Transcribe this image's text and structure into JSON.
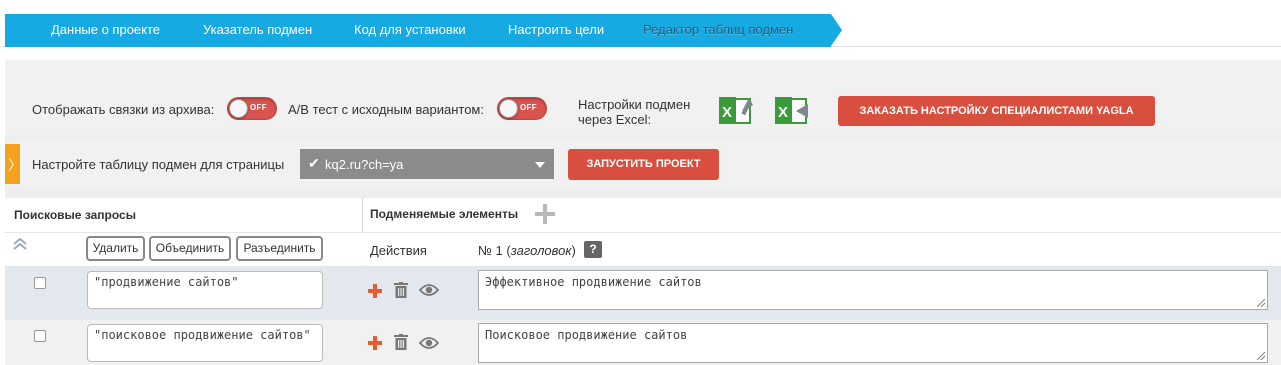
{
  "tabs": [
    {
      "label": "Данные о проекте"
    },
    {
      "label": "Указатель подмен"
    },
    {
      "label": "Код для установки"
    },
    {
      "label": "Настроить цели"
    },
    {
      "label": "Редактор таблиц подмен"
    }
  ],
  "settings": {
    "archive_label": "Отображать связки из архива:",
    "ab_label": "A/B тест с исходным вариантом:",
    "toggle_off": "OFF",
    "excel_label_line1": "Настройки подмен",
    "excel_label_line2": "через Excel:",
    "order_button": "Заказать настройку специалистами YAGLA"
  },
  "page_row": {
    "side_tab_glyph": "〉",
    "label": "Настройте таблицу подмен для страницы",
    "select_value": "kq2.ru?ch=ya",
    "launch_button": "Запустить проект"
  },
  "table": {
    "queries_header": "Поисковые запросы",
    "elements_header": "Подменяемые элементы",
    "buttons": {
      "delete": "Удалить",
      "merge": "Объединить",
      "split": "Разъединить"
    },
    "actions_label": "Действия",
    "col1_prefix": "№ 1 (",
    "col1_type": "заголовок",
    "col1_suffix": ")",
    "help_label": "?",
    "rows": [
      {
        "query": "\"продвижение сайтов\"",
        "value": "Эффективное продвижение сайтов"
      },
      {
        "query": "\"поисковое продвижение сайтов\"",
        "value": "Поисковое продвижение сайтов"
      }
    ]
  },
  "colors": {
    "tabs": "#17a9e1",
    "red_button": "#d94f3f",
    "side_tab": "#f6a21c",
    "select": "#8b8b8b"
  }
}
